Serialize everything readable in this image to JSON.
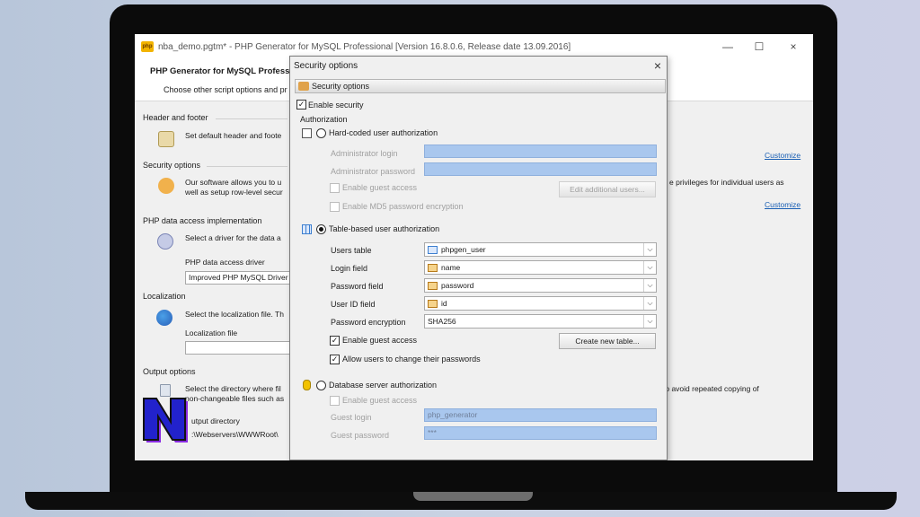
{
  "window": {
    "title": "nba_demo.pgtm* - PHP Generator for MySQL Professional [Version 16.8.0.6, Release date 13.09.2016]",
    "app_icon_text": "php",
    "header_title": "PHP Generator for MySQL Profess",
    "header_subtitle": "Choose other script options and pr"
  },
  "sections": {
    "header_footer": {
      "title": "Header and footer",
      "text": "Set default header and foote"
    },
    "security": {
      "title": "Security options",
      "text_line1": "Our software allows you to u",
      "text_line2": "well as setup row-level secur",
      "text_right": "e privileges for individual users as"
    },
    "data_access": {
      "title": "PHP data access implementation",
      "text": "Select a driver for the data a",
      "driver_label": "PHP data access driver",
      "driver_value": "Improved PHP MySQL Driver"
    },
    "localization": {
      "title": "Localization",
      "text": "Select the localization file. Th",
      "file_label": "Localization file"
    },
    "output": {
      "title": "Output options",
      "text_line1": "Select the directory where fil",
      "text_line2": "non-changeable files such as",
      "text_right": "to avoid repeated copying of",
      "dir_label": "utput directory",
      "dir_value": ":\\Webservers\\WWWRoot\\"
    }
  },
  "links": {
    "customize1": "Customize",
    "customize2": "Customize"
  },
  "dialog": {
    "title": "Security options",
    "tab": "Security options",
    "enable_security": "Enable security",
    "authorization_group": "Authorization",
    "hardcoded": {
      "label": "Hard-coded user authorization",
      "admin_login_label": "Administrator login",
      "admin_password_label": "Administrator password",
      "enable_guest": "Enable guest access",
      "edit_users_button": "Edit additional users...",
      "md5": "Enable MD5 password encryption"
    },
    "table_based": {
      "label": "Table-based user authorization",
      "users_table_label": "Users table",
      "users_table_value": "phpgen_user",
      "login_field_label": "Login field",
      "login_field_value": "name",
      "password_field_label": "Password field",
      "password_field_value": "password",
      "user_id_label": "User ID field",
      "user_id_value": "id",
      "encryption_label": "Password encryption",
      "encryption_value": "SHA256",
      "enable_guest": "Enable guest access",
      "create_table_button": "Create new table...",
      "allow_change": "Allow users to change their passwords"
    },
    "db_server": {
      "label": "Database server authorization",
      "enable_guest": "Enable guest access",
      "guest_login_label": "Guest login",
      "guest_login_value": "php_generator",
      "guest_password_label": "Guest password",
      "guest_password_value": "***"
    }
  },
  "icons": {
    "close": "×",
    "minimize": "—",
    "maximize": "☐",
    "check": "✓",
    "dropdown": "⌵"
  },
  "colors": {
    "accent_input": "#a9c7ee",
    "link": "#1a5fb4",
    "logo_blue": "#2222cc",
    "logo_purple": "#8a2be2"
  }
}
